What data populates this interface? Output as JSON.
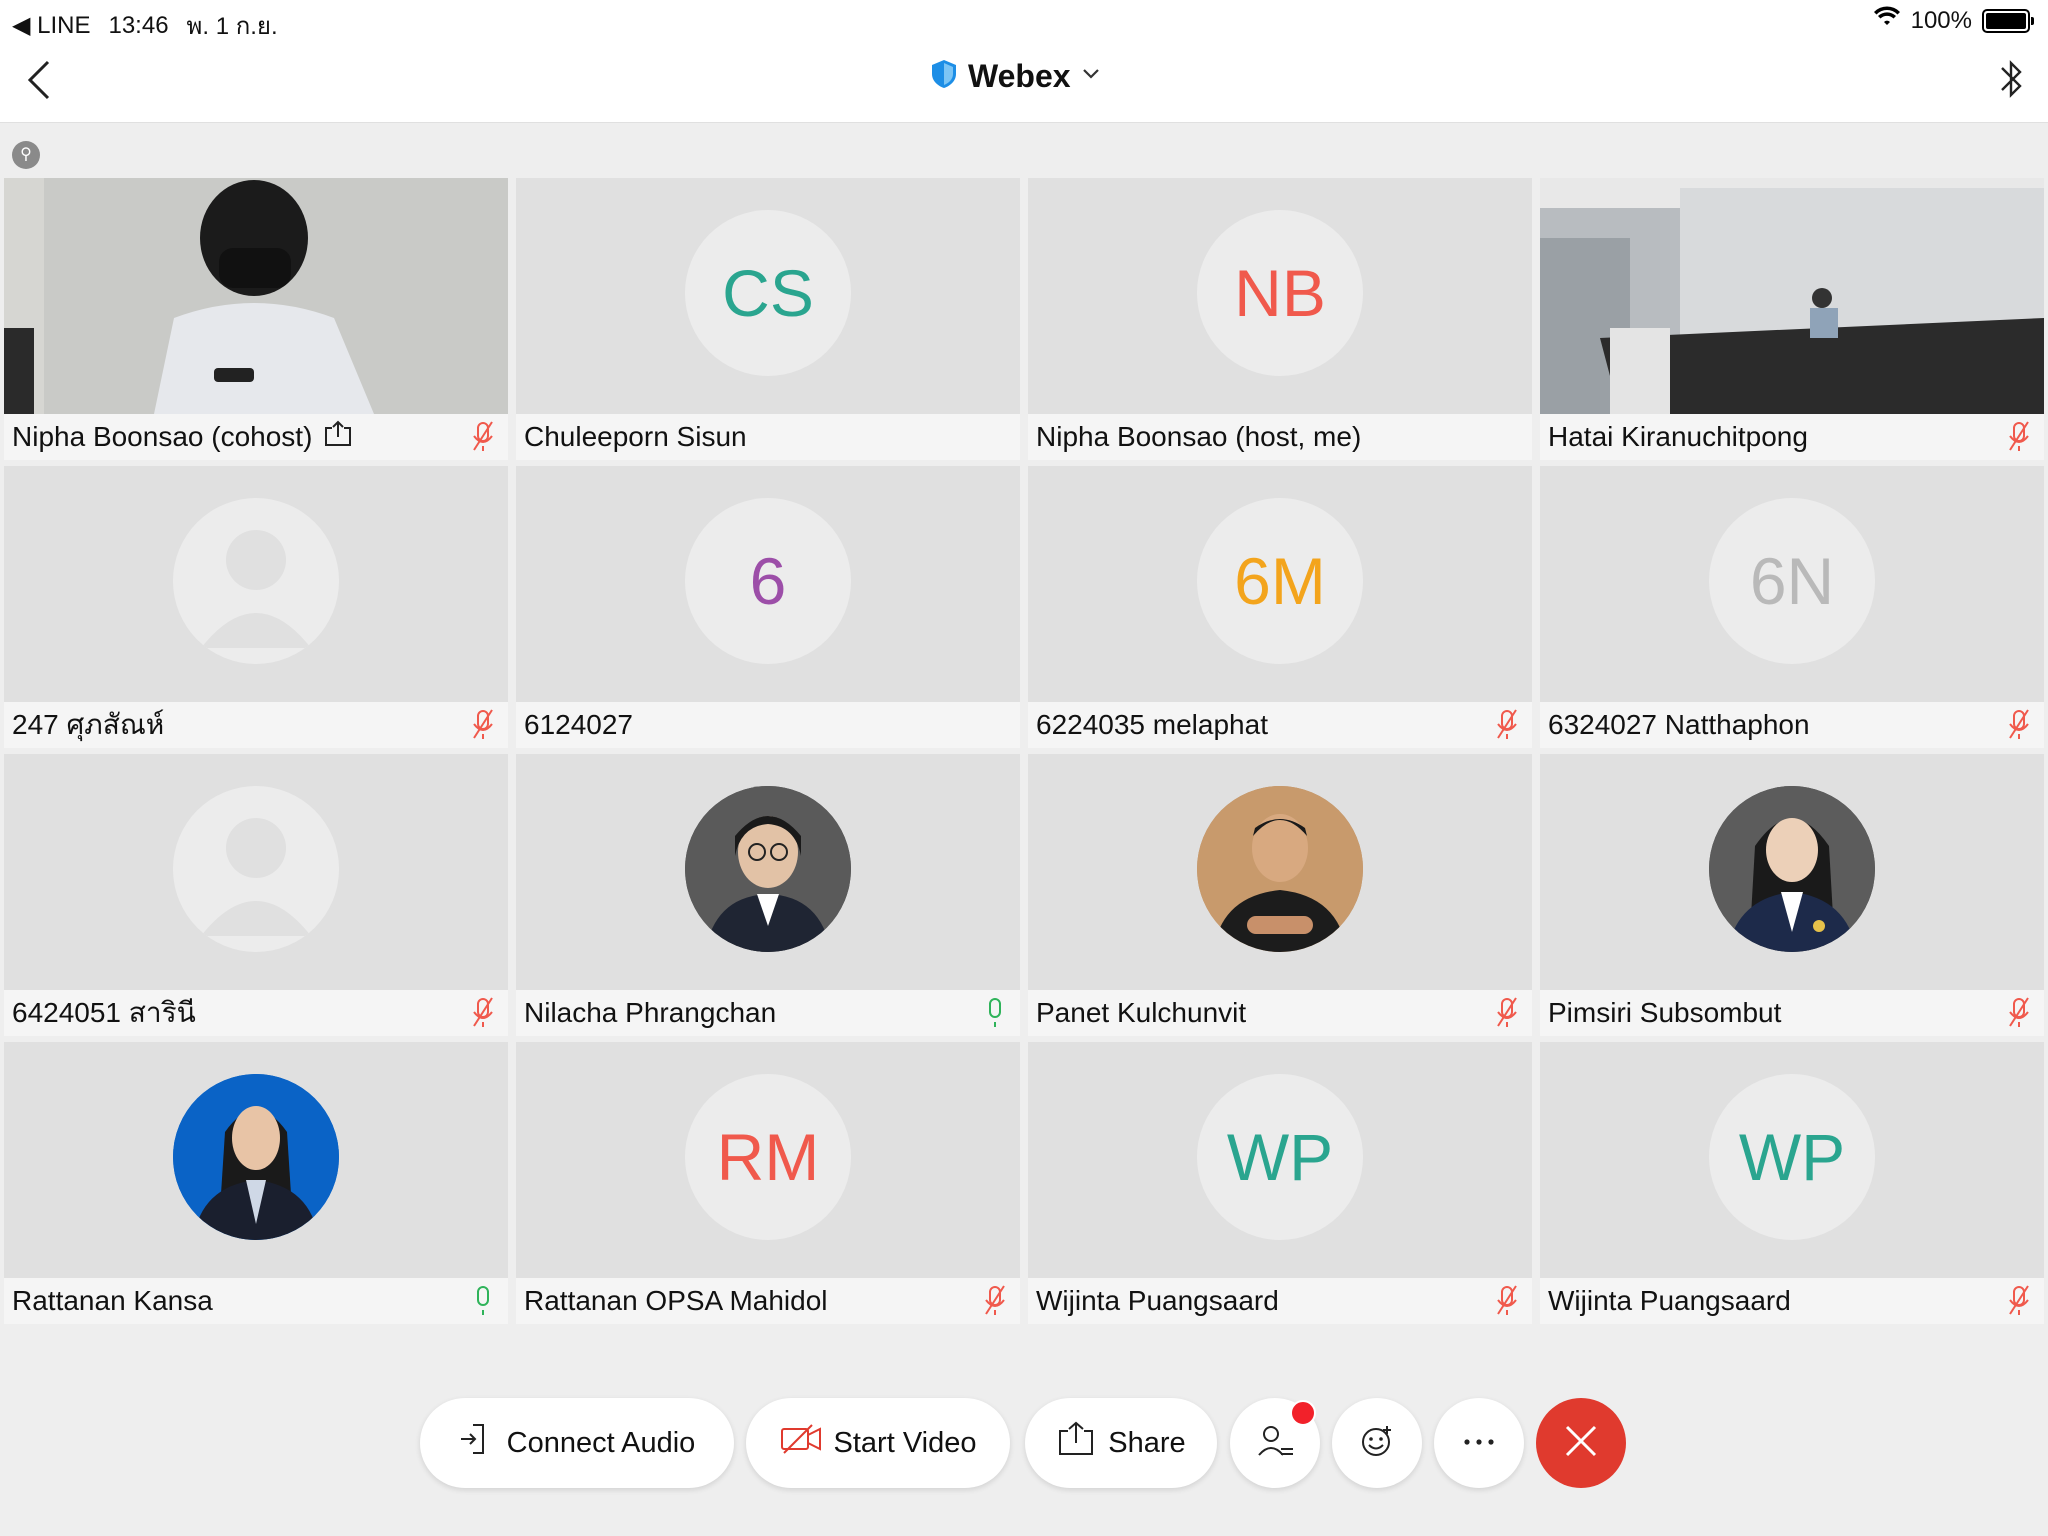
{
  "status_bar": {
    "back_app": "◀ LINE",
    "time": "13:46",
    "date": "พ. 1 ก.ย.",
    "battery": "100%"
  },
  "nav": {
    "title": "Webex"
  },
  "participants": [
    {
      "name": "Nipha Boonsao (cohost)",
      "initials": "",
      "kind": "video",
      "mic": "muted",
      "sharing": true,
      "active": true
    },
    {
      "name": "Chuleeporn Sisun",
      "initials": "CS",
      "kind": "initials",
      "color": "#2aa58f",
      "mic": "none"
    },
    {
      "name": "Nipha Boonsao (host, me)",
      "initials": "NB",
      "kind": "initials",
      "color": "#f0594c",
      "mic": "none"
    },
    {
      "name": "Hatai Kiranuchitpong",
      "initials": "",
      "kind": "room",
      "mic": "muted"
    },
    {
      "name": "247 ศุภสัณห์",
      "initials": "",
      "kind": "placeholder",
      "mic": "muted"
    },
    {
      "name": "6124027",
      "initials": "6",
      "kind": "initials",
      "color": "#9c4ea8",
      "mic": "none"
    },
    {
      "name": "6224035 melaphat",
      "initials": "6M",
      "kind": "initials",
      "color": "#f3a41c",
      "mic": "muted"
    },
    {
      "name": "6324027 Natthaphon",
      "initials": "6N",
      "kind": "initials",
      "color": "#b9b9b9",
      "mic": "muted"
    },
    {
      "name": "6424051 สารินี",
      "initials": "",
      "kind": "placeholder",
      "mic": "muted"
    },
    {
      "name": "Nilacha Phrangchan",
      "initials": "",
      "kind": "photo",
      "photo_bg": "#4a4a4a",
      "mic": "on"
    },
    {
      "name": "Panet Kulchunvit",
      "initials": "",
      "kind": "photo",
      "photo_bg": "#b78a5c",
      "mic": "muted"
    },
    {
      "name": "Pimsiri Subsombut",
      "initials": "",
      "kind": "photo",
      "photo_bg": "#505050",
      "mic": "muted"
    },
    {
      "name": "Rattanan Kansa",
      "initials": "",
      "kind": "photo",
      "photo_bg": "#0a63c6",
      "mic": "on"
    },
    {
      "name": "Rattanan OPSA Mahidol",
      "initials": "RM",
      "kind": "initials",
      "color": "#f0594c",
      "mic": "muted"
    },
    {
      "name": "Wijinta Puangsaard",
      "initials": "WP",
      "kind": "initials",
      "color": "#2aa58f",
      "mic": "muted"
    },
    {
      "name": "Wijinta Puangsaard",
      "initials": "WP",
      "kind": "initials",
      "color": "#2aa58f",
      "mic": "muted"
    }
  ],
  "toolbar": {
    "connect_audio": "Connect Audio",
    "start_video": "Start Video",
    "share": "Share"
  },
  "colors": {
    "accent": "#1b6fa8",
    "muted_mic": "#f0594c",
    "mic_on": "#2fb35a",
    "end_call": "#e03a2e"
  }
}
